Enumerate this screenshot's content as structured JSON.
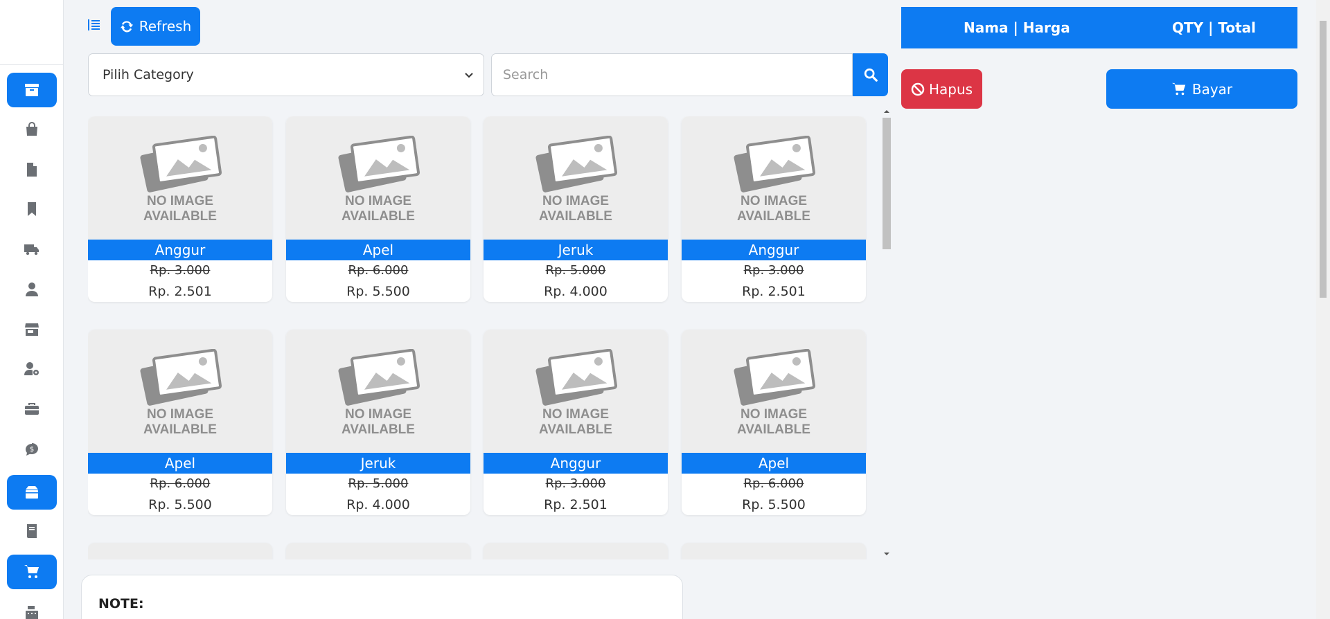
{
  "toolbar": {
    "refresh_label": "Refresh"
  },
  "filters": {
    "category_selected": "Pilih Category",
    "search_placeholder": "Search"
  },
  "products": [
    {
      "name": "Anggur",
      "price_old": "Rp. 3.000",
      "price": "Rp. 2.501",
      "image_text": "NO IMAGE AVAILABLE"
    },
    {
      "name": "Apel",
      "price_old": "Rp. 6.000",
      "price": "Rp. 5.500",
      "image_text": "NO IMAGE AVAILABLE"
    },
    {
      "name": "Jeruk",
      "price_old": "Rp. 5.000",
      "price": "Rp. 4.000",
      "image_text": "NO IMAGE AVAILABLE"
    },
    {
      "name": "Anggur",
      "price_old": "Rp. 3.000",
      "price": "Rp. 2.501",
      "image_text": "NO IMAGE AVAILABLE"
    },
    {
      "name": "Apel",
      "price_old": "Rp. 6.000",
      "price": "Rp. 5.500",
      "image_text": "NO IMAGE AVAILABLE"
    },
    {
      "name": "Jeruk",
      "price_old": "Rp. 5.000",
      "price": "Rp. 4.000",
      "image_text": "NO IMAGE AVAILABLE"
    },
    {
      "name": "Anggur",
      "price_old": "Rp. 3.000",
      "price": "Rp. 2.501",
      "image_text": "NO IMAGE AVAILABLE"
    },
    {
      "name": "Apel",
      "price_old": "Rp. 6.000",
      "price": "Rp. 5.500",
      "image_text": "NO IMAGE AVAILABLE"
    }
  ],
  "note": {
    "label": "NOTE:"
  },
  "cart": {
    "col_left": "Nama | Harga",
    "col_right": "QTY | Total",
    "clear_label": "Hapus",
    "pay_label": "Bayar"
  },
  "sidebar": {
    "items": [
      {
        "icon": "archive-icon",
        "active": true
      },
      {
        "icon": "shopping-bag-icon",
        "active": false
      },
      {
        "icon": "file-icon",
        "active": false
      },
      {
        "icon": "bookmark-icon",
        "active": false
      },
      {
        "icon": "truck-icon",
        "active": false
      },
      {
        "icon": "user-tie-icon",
        "active": false
      },
      {
        "icon": "store-icon",
        "active": false
      },
      {
        "icon": "user-cog-icon",
        "active": false
      },
      {
        "icon": "toolbox-icon",
        "active": false
      },
      {
        "icon": "dollar-comment-icon",
        "active": false
      },
      {
        "icon": "box-open-icon",
        "active": true
      },
      {
        "icon": "book-icon",
        "active": false
      },
      {
        "icon": "cart-icon",
        "active": true
      },
      {
        "icon": "cash-register-icon",
        "active": false
      }
    ]
  },
  "colors": {
    "primary": "#0d7bf2",
    "danger": "#dc3545",
    "background": "#f2f4f7"
  }
}
